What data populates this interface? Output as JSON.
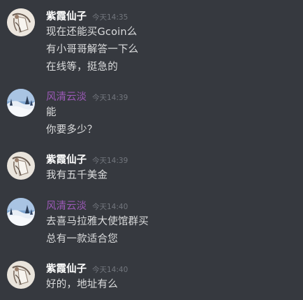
{
  "colors": {
    "background": "#36393f",
    "username_white": "#ffffff",
    "username_purple": "#9b59b6",
    "timestamp": "#72767d",
    "message_text": "#dcddde"
  },
  "groups": [
    {
      "username": "紫霞仙子",
      "avatar": "ink-sketch-avatar",
      "timestamp": "今天14:35",
      "messages": [
        "现在还能买Gcoin么",
        "有小哥哥解答一下么",
        "在线等，挺急的"
      ]
    },
    {
      "username": "风清云淡",
      "avatar": "snowy-landscape-avatar",
      "timestamp": "今天14:39",
      "messages": [
        "能",
        "你要多少？"
      ]
    },
    {
      "username": "紫霞仙子",
      "avatar": "ink-sketch-avatar",
      "timestamp": "今天14:39",
      "messages": [
        "我有五千美金"
      ]
    },
    {
      "username": "风清云淡",
      "avatar": "snowy-landscape-avatar",
      "timestamp": "今天14:40",
      "messages": [
        "去喜马拉雅大使馆群买",
        "总有一款适合您"
      ]
    },
    {
      "username": "紫霞仙子",
      "avatar": "ink-sketch-avatar",
      "timestamp": "今天14:40",
      "messages": [
        "好的，地址有么"
      ]
    }
  ]
}
